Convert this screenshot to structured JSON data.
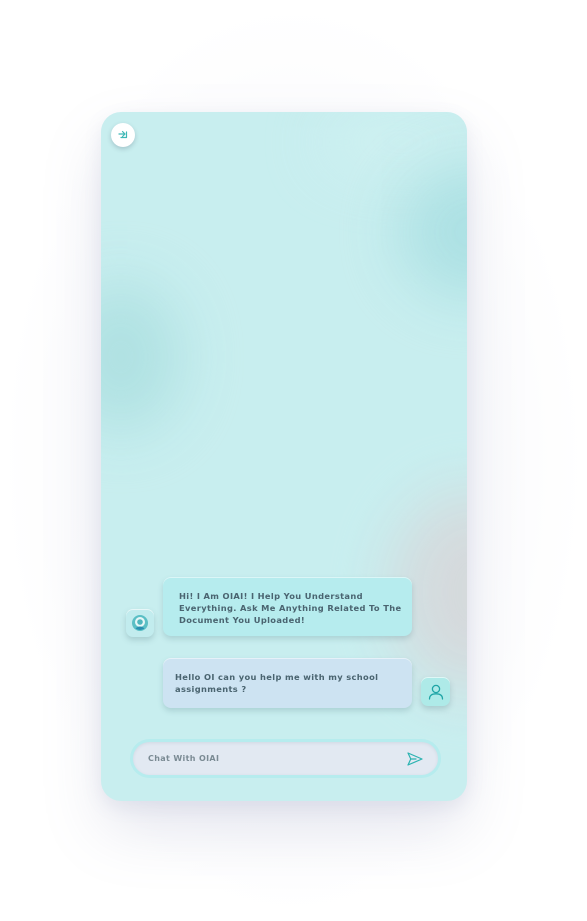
{
  "header": {
    "back_icon": "arrow-in-icon"
  },
  "messages": [
    {
      "sender": "bot",
      "avatar_icon": "bot-avatar-icon",
      "text": "Hi! I Am OIAI! I Help You Understand Everything. Ask Me Anything Related To The Document You Uploaded!"
    },
    {
      "sender": "user",
      "avatar_icon": "user-icon",
      "text": "Hello OI can you help me with my school assignments ?"
    }
  ],
  "composer": {
    "placeholder": "Chat With OIAI",
    "value": "",
    "send_icon": "send-icon"
  },
  "colors": {
    "background": "#c8eeef",
    "bot_bubble": "#b6ecee",
    "user_bubble": "#cde3f2",
    "input": "#e2e9f2",
    "accent": "#2bb3b1",
    "text": "#4a6470"
  }
}
